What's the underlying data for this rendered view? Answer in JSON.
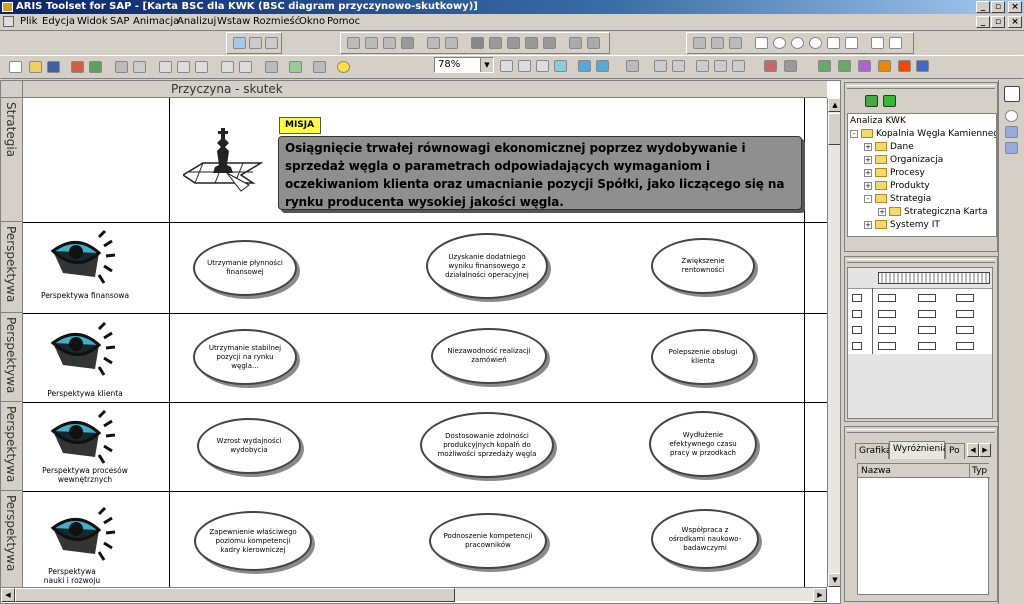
{
  "window": {
    "title": "ARIS Toolset for SAP - [Karta BSC dla KWK (BSC diagram przyczynowo-skutkowy)]",
    "minimize": "_",
    "restore": "▫",
    "close": "×"
  },
  "menu": [
    "Plik",
    "Edycja",
    "Widok",
    "SAP",
    "Animacja",
    "Analizuj",
    "Wstaw",
    "Rozmieść",
    "Okno",
    "Pomoc"
  ],
  "toolbar": {
    "zoom": "78%"
  },
  "diagram": {
    "header": "Przyczyna - skutek",
    "lanes": [
      "Strategia",
      "Perspektywa",
      "Perspektywa",
      "Perspektywa",
      "Perspektywa"
    ],
    "mission": {
      "tag": "MISJA",
      "text": "Osiągnięcie trwałej równowagi ekonomicznej poprzez wydobywanie i sprzedaż węgla o parametrach odpowiadających wymaganiom i oczekiwaniom klienta oraz umacnianie pozycji Spółki, jako liczącego się na rynku producenta wysokiej jakości węgla."
    },
    "perspectives": [
      {
        "label": "Perspektywa finansowa",
        "goals": [
          "Utrzymanie płynności finansowej",
          "Uzyskanie dodatniego wyniku finansowego z działalności operacyjnej",
          "Zwiększenie rentowności"
        ]
      },
      {
        "label": "Perspektywa klienta",
        "goals": [
          "Utrzymanie stabilnej pozycji na rynku węgla...",
          "Niezawodność realizacji zamówień",
          "Polepszenie obsługi klienta"
        ]
      },
      {
        "label": "Perspektywa procesów wewnętrznych",
        "goals": [
          "Wzrost wydajności wydobycia",
          "Dostosowanie zdolności produkcyjnych kopalń do możliwości sprzedaży węgla",
          "Wydłużenie efektywnego czasu pracy w przodkach"
        ]
      },
      {
        "label": "Perspektywa nauki i rozwoju",
        "goals": [
          "Zapewnienie właściwego poziomu kompetencji kadry kierowniczej",
          "Podnoszenie kompetencji pracowników",
          "Współpraca z ośrodkami naukowo-badawczymi"
        ]
      }
    ]
  },
  "explorer": {
    "tree": [
      {
        "label": "Analiza KWK",
        "level": 0,
        "toggle": ""
      },
      {
        "label": "Kopalnia Węgla Kamiennego",
        "level": 1,
        "toggle": "-"
      },
      {
        "label": "Dane",
        "level": 2,
        "toggle": "+"
      },
      {
        "label": "Organizacja",
        "level": 2,
        "toggle": "+"
      },
      {
        "label": "Procesy",
        "level": 2,
        "toggle": "+"
      },
      {
        "label": "Produkty",
        "level": 2,
        "toggle": "+"
      },
      {
        "label": "Strategia",
        "level": 2,
        "toggle": "-"
      },
      {
        "label": "Strategiczna Karta",
        "level": 3,
        "toggle": "+"
      },
      {
        "label": "Systemy IT",
        "level": 2,
        "toggle": "+"
      }
    ],
    "tabs": [
      "Grafika",
      "Wyróżnienia",
      "Po"
    ],
    "columns": [
      "Nazwa",
      "Typ"
    ]
  }
}
